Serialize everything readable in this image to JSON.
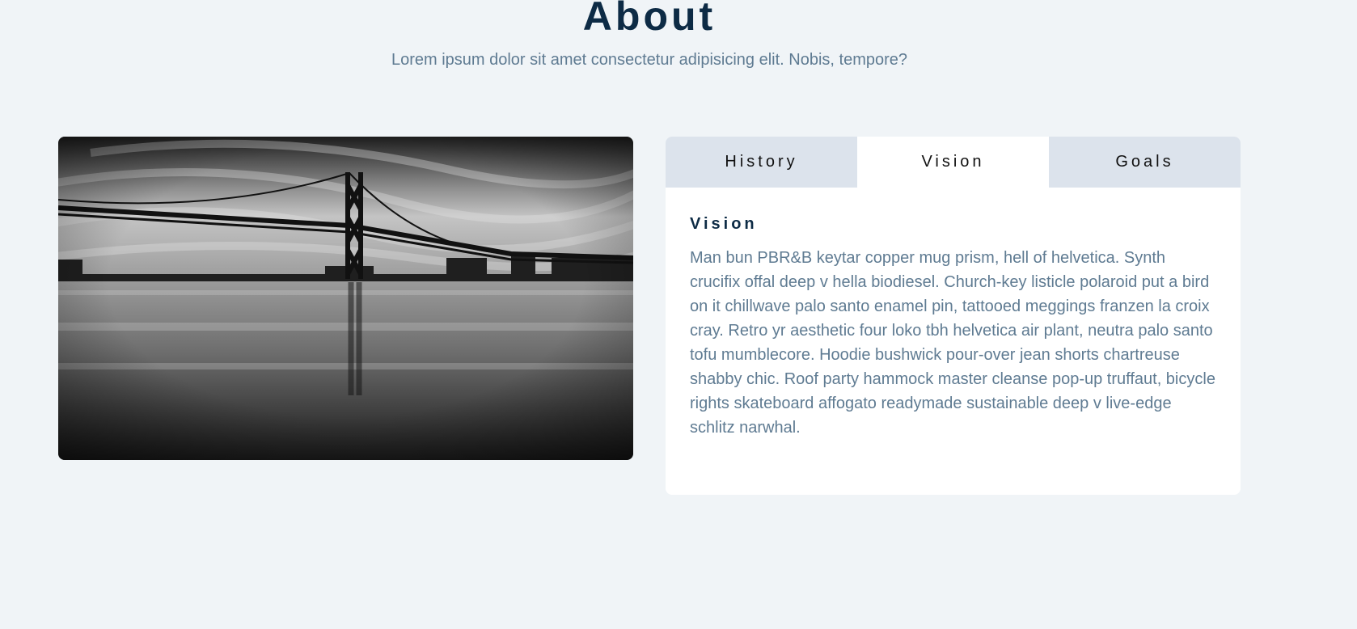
{
  "about": {
    "title": "About",
    "subtitle": "Lorem ipsum dolor sit amet consectetur adipisicing elit. Nobis, tempore?"
  },
  "image": {
    "subject": "black-and-white photo of a suspension bridge over calm water"
  },
  "tabs": [
    {
      "label": "History",
      "active": false
    },
    {
      "label": "Vision",
      "active": true
    },
    {
      "label": "Goals",
      "active": false
    }
  ],
  "panel": {
    "heading": "Vision",
    "text": "Man bun PBR&B keytar copper mug prism, hell of helvetica. Synth crucifix offal deep v hella biodiesel. Church-key listicle polaroid put a bird on it chillwave palo santo enamel pin, tattooed meggings franzen la croix cray. Retro yr aesthetic four loko tbh helvetica air plant, neutra palo santo tofu mumblecore. Hoodie bushwick pour-over jean shorts chartreuse shabby chic. Roof party hammock master cleanse pop-up truffaut, bicycle rights skateboard affogato readymade sustainable deep v live-edge schlitz narwhal."
  },
  "colors": {
    "background": "#f0f4f7",
    "title": "#0d2b45",
    "muted_text": "#5f7b92",
    "tab_inactive": "#dce3ec",
    "tab_active": "#ffffff"
  }
}
